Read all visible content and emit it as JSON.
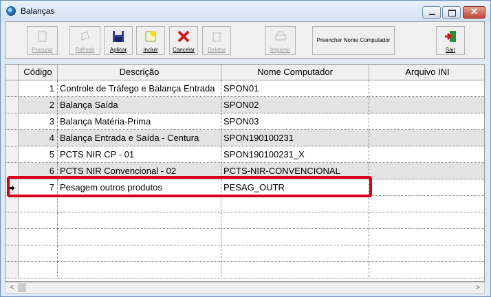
{
  "window": {
    "title": "Balanças"
  },
  "toolbar": {
    "procurar": "Procurar",
    "refresh": "Refresh",
    "aplicar": "Aplicar",
    "incluir": "Incluir",
    "cancelar": "Cancelar",
    "deletar": "Deletar",
    "imprimir": "Imprimir",
    "preencher": "Preencher Nome Computador",
    "sair": "Sair"
  },
  "grid": {
    "columns": [
      "Código",
      "Descrição",
      "Nome Computador",
      "Arquivo INI"
    ],
    "current_row_marker": "➡",
    "rows": [
      {
        "codigo": "1",
        "descricao": "Controle de Tráfego e Balança Entrada",
        "computador": "SPON01",
        "ini": ""
      },
      {
        "codigo": "2",
        "descricao": "Balança Saída",
        "computador": "SPON02",
        "ini": ""
      },
      {
        "codigo": "3",
        "descricao": "Balança Matéria-Prima",
        "computador": "SPON03",
        "ini": ""
      },
      {
        "codigo": "4",
        "descricao": "Balança Entrada e Saída - Centura",
        "computador": "SPON190100231",
        "ini": ""
      },
      {
        "codigo": "5",
        "descricao": "PCTS NIR CP - 01",
        "computador": "SPON190100231_X",
        "ini": ""
      },
      {
        "codigo": "6",
        "descricao": "PCTS NIR Convencional - 02",
        "computador": "PCTS-NIR-CONVENCIONAL",
        "ini": ""
      },
      {
        "codigo": "7",
        "descricao": "Pesagem outros produtos",
        "computador": "PESAG_OUTR",
        "ini": ""
      }
    ]
  },
  "scrollbar": {
    "left_arrow": "<",
    "right_arrow": ">"
  },
  "colors": {
    "highlight": "#d8001a",
    "alt_row": "#e3e3e3"
  }
}
